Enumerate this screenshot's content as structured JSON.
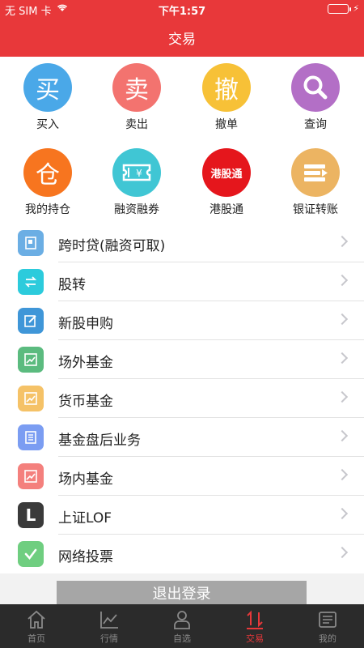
{
  "status": {
    "carrier": "无 SIM 卡",
    "time": "下午1:57"
  },
  "header": {
    "title": "交易"
  },
  "grid": [
    {
      "label": "买入",
      "glyph": "买",
      "color": "#4aa8e8"
    },
    {
      "label": "卖出",
      "glyph": "卖",
      "color": "#f3736f"
    },
    {
      "label": "撤单",
      "glyph": "撤",
      "color": "#f7c137"
    },
    {
      "label": "查询",
      "glyph": "search-icon",
      "color": "#b36fc6"
    },
    {
      "label": "我的持仓",
      "glyph": "仓",
      "color": "#f7751f"
    },
    {
      "label": "融资融券",
      "glyph": "ticket-icon",
      "color": "#40c6d4"
    },
    {
      "label": "港股通",
      "glyph": "港股通",
      "color": "#e5161c"
    },
    {
      "label": "银证转账",
      "glyph": "transfer-icon",
      "color": "#ecb462"
    }
  ],
  "list": [
    {
      "label": "跨时贷(融资可取)",
      "color": "#6baee4",
      "icon": "book-icon"
    },
    {
      "label": "股转",
      "color": "#2ccbdc",
      "icon": "swap-icon"
    },
    {
      "label": "新股申购",
      "color": "#3f96d8",
      "icon": "edit-icon"
    },
    {
      "label": "场外基金",
      "color": "#5bbb7f",
      "icon": "chart-icon"
    },
    {
      "label": "货币基金",
      "color": "#f5c267",
      "icon": "chart-icon"
    },
    {
      "label": "基金盘后业务",
      "color": "#7b9df2",
      "icon": "doc-icon"
    },
    {
      "label": "场内基金",
      "color": "#f4807d",
      "icon": "chart-icon"
    },
    {
      "label": "上证LOF",
      "color": "#3a3a3a",
      "glyph": "L"
    },
    {
      "label": "网络投票",
      "color": "#6fce80",
      "icon": "check-icon"
    }
  ],
  "logout_label": "退出登录",
  "tabs": [
    {
      "label": "首页"
    },
    {
      "label": "行情"
    },
    {
      "label": "自选"
    },
    {
      "label": "交易"
    },
    {
      "label": "我的"
    }
  ],
  "colors": {
    "accent": "#e8383a",
    "tabbar": "#2b2b2b"
  }
}
